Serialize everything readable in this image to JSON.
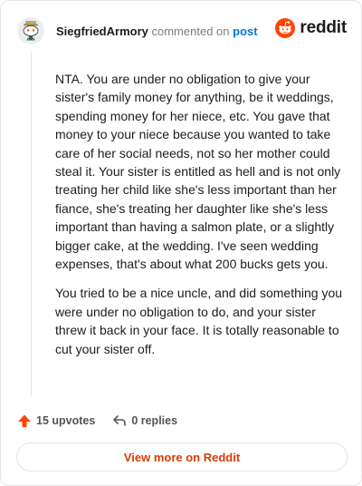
{
  "comment": {
    "username": "SiegfriedArmory",
    "action_text": "commented on",
    "post_link": "post",
    "paragraphs": [
      "NTA. You are under no obligation to give your sister's family money for anything, be it weddings, spending money for her niece, etc. You gave that money to your niece because you wanted to take care of her social needs, not so her mother could steal it. Your sister is entitled as hell and is not only treating her child like she's less important than her fiance, she's treating her daughter like she's less important than having a salmon plate, or a slightly bigger cake, at the wedding. I've seen wedding expenses, that's about what 200 bucks gets you.",
      "You tried to be a nice uncle, and did something you were under no obligation to do, and your sister threw it back in your face. It is totally reasonable to cut your sister off."
    ]
  },
  "brand": {
    "wordmark": "reddit",
    "icon": "reddit-snoo-icon",
    "color": "#ff4500"
  },
  "actions": {
    "upvotes_label": "15 upvotes",
    "upvote_icon": "upvote-arrow-icon",
    "replies_label": "0 replies",
    "reply_icon": "reply-arrow-icon",
    "upvote_color": "#ff4500"
  },
  "view_more_label": "View more on Reddit",
  "colors": {
    "link": "#0079d3",
    "view_more": "#d93a00"
  }
}
